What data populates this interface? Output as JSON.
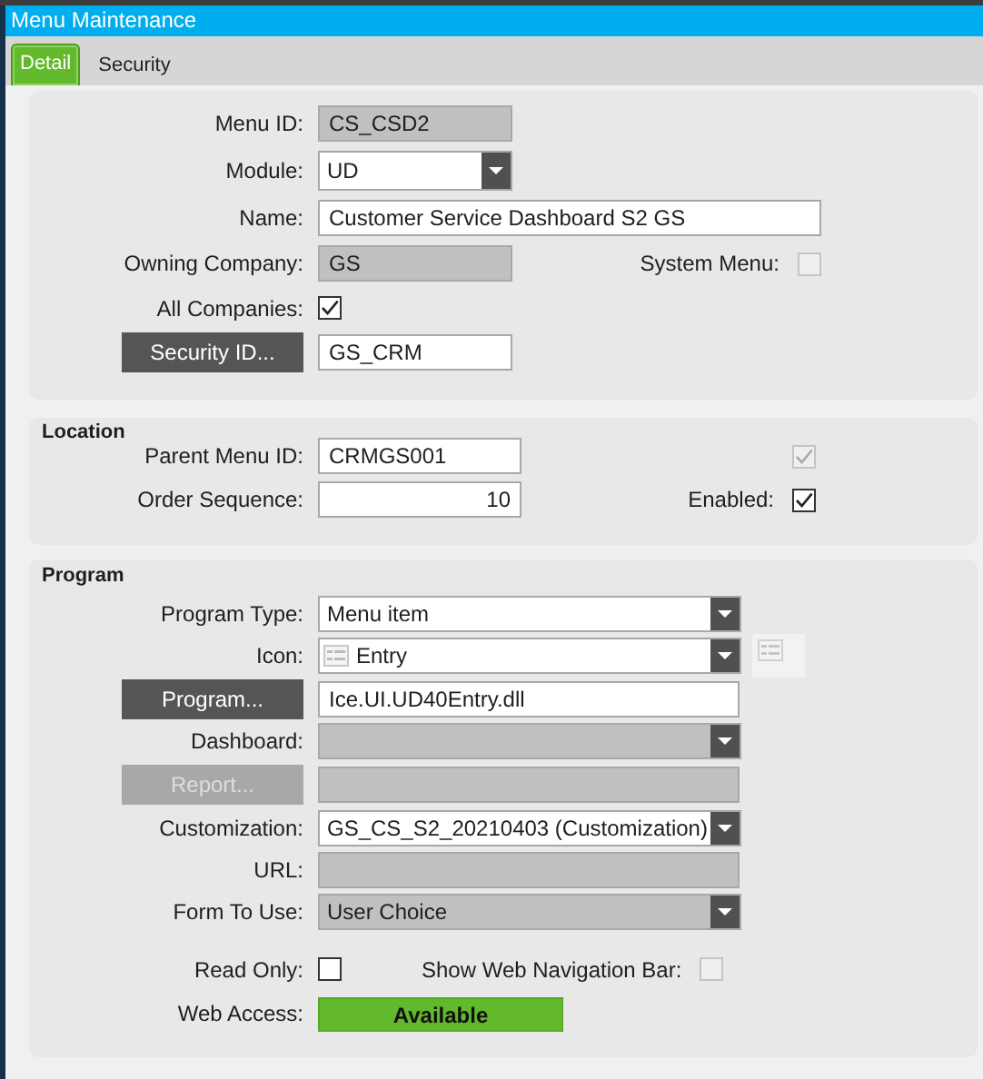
{
  "window": {
    "title": "Menu Maintenance"
  },
  "tabs": [
    {
      "label": "Detail",
      "selected": true
    },
    {
      "label": "Security",
      "selected": false
    }
  ],
  "sections": [
    {
      "rows": [
        {
          "label": "Menu ID:",
          "control": {
            "kind": "text",
            "value": "CS_CSD2",
            "readonly": true
          }
        },
        {
          "label": "Module:",
          "control": {
            "kind": "dropdown",
            "value": "UD",
            "readonly": false
          }
        },
        {
          "label": "Name:",
          "control": {
            "kind": "text",
            "value": "Customer Service Dashboard S2 GS",
            "readonly": false
          }
        },
        {
          "label": "Owning Company:",
          "control": {
            "kind": "text",
            "value": "GS",
            "readonly": true
          },
          "extra": {
            "label": "System Menu:",
            "checked": false,
            "disabled": true
          }
        },
        {
          "label": "All Companies:",
          "control": {
            "kind": "checkbox",
            "checked": true,
            "disabled": false
          }
        },
        {
          "button": {
            "label": "Security ID...",
            "disabled": false
          },
          "control": {
            "kind": "text",
            "value": "GS_CRM",
            "readonly": false
          }
        }
      ]
    },
    {
      "title": "Location",
      "rows": [
        {
          "label": "Parent Menu ID:",
          "control": {
            "kind": "text",
            "value": "CRMGS001",
            "readonly": false
          },
          "extra": {
            "checked": true,
            "disabled": true
          }
        },
        {
          "label": "Order Sequence:",
          "control": {
            "kind": "number",
            "value": "10",
            "readonly": false
          },
          "extra": {
            "label": "Enabled:",
            "checked": true,
            "disabled": false
          }
        }
      ]
    },
    {
      "title": "Program",
      "rows": [
        {
          "label": "Program Type:",
          "control": {
            "kind": "dropdown",
            "value": "Menu item",
            "readonly": false
          }
        },
        {
          "label": "Icon:",
          "control": {
            "kind": "icon-dropdown",
            "value": "Entry",
            "readonly": false
          }
        },
        {
          "button": {
            "label": "Program...",
            "disabled": false
          },
          "control": {
            "kind": "text",
            "value": "Ice.UI.UD40Entry.dll",
            "readonly": false
          }
        },
        {
          "label": "Dashboard:",
          "control": {
            "kind": "dropdown",
            "readonly": true
          }
        },
        {
          "button": {
            "label": "Report...",
            "disabled": true
          },
          "control": {
            "kind": "text",
            "readonly": true
          }
        },
        {
          "label": "Customization:",
          "control": {
            "kind": "dropdown",
            "value": "GS_CS_S2_20210403 (Customization)",
            "readonly": false
          }
        },
        {
          "label": "URL:",
          "control": {
            "kind": "text",
            "readonly": true
          }
        },
        {
          "label": "Form To Use:",
          "control": {
            "kind": "dropdown",
            "value": "User Choice",
            "readonly": true
          }
        },
        {
          "label": "Read Only:",
          "control": {
            "kind": "checkbox",
            "checked": false,
            "disabled": false
          },
          "extra": {
            "label": "Show Web Navigation Bar:",
            "checked": false,
            "disabled": true
          }
        },
        {
          "label": "Web Access:",
          "control": {
            "kind": "status",
            "value": "Available"
          }
        }
      ]
    }
  ]
}
